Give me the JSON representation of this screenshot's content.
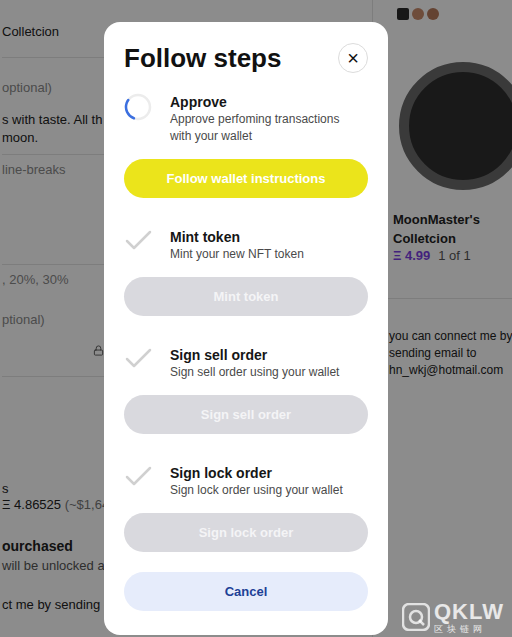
{
  "page": {
    "left": {
      "collection_value": "Colletcion",
      "description_label": "optional)",
      "description_lines": [
        "s with taste. All th",
        "moon."
      ],
      "description_hint": "line-breaks",
      "royalties_hint": ", 20%, 30%",
      "unlockable_label": "ptional)",
      "price_label": "s",
      "price_value": "Ξ 4.86525",
      "price_usd": "(~$1,646",
      "unlock_title": "ourchased",
      "unlock_note": "will be unlocked aft",
      "contact_note": "ct me by sending e"
    },
    "preview": {
      "title_lines": [
        "MoonMaster's",
        "Colletcion"
      ],
      "price": "Ξ 4.99",
      "edition": "1 of 1",
      "note_lines": [
        "you can connect me by",
        "sending email to",
        "hn_wkj@hotmail.com"
      ]
    }
  },
  "dialog": {
    "title": "Follow steps",
    "close": "×",
    "steps": [
      {
        "title": "Approve",
        "description_lines": [
          "Approve perfoming transactions",
          "with your wallet"
        ],
        "button": "Follow wallet instructions",
        "state": "in_progress",
        "disabled": false
      },
      {
        "title": "Mint token",
        "description_lines": [
          "Mint your new NFT token"
        ],
        "button": "Mint token",
        "state": "waiting",
        "disabled": true
      },
      {
        "title": "Sign sell order",
        "description_lines": [
          "Sign sell order using your wallet"
        ],
        "button": "Sign sell order",
        "state": "waiting",
        "disabled": true
      },
      {
        "title": "Sign lock order",
        "description_lines": [
          "Sign lock order using your wallet"
        ],
        "button": "Sign lock order",
        "state": "waiting",
        "disabled": true
      }
    ],
    "cancel": "Cancel"
  },
  "watermark": {
    "logo": "QKLW",
    "caption": "区块链网"
  }
}
